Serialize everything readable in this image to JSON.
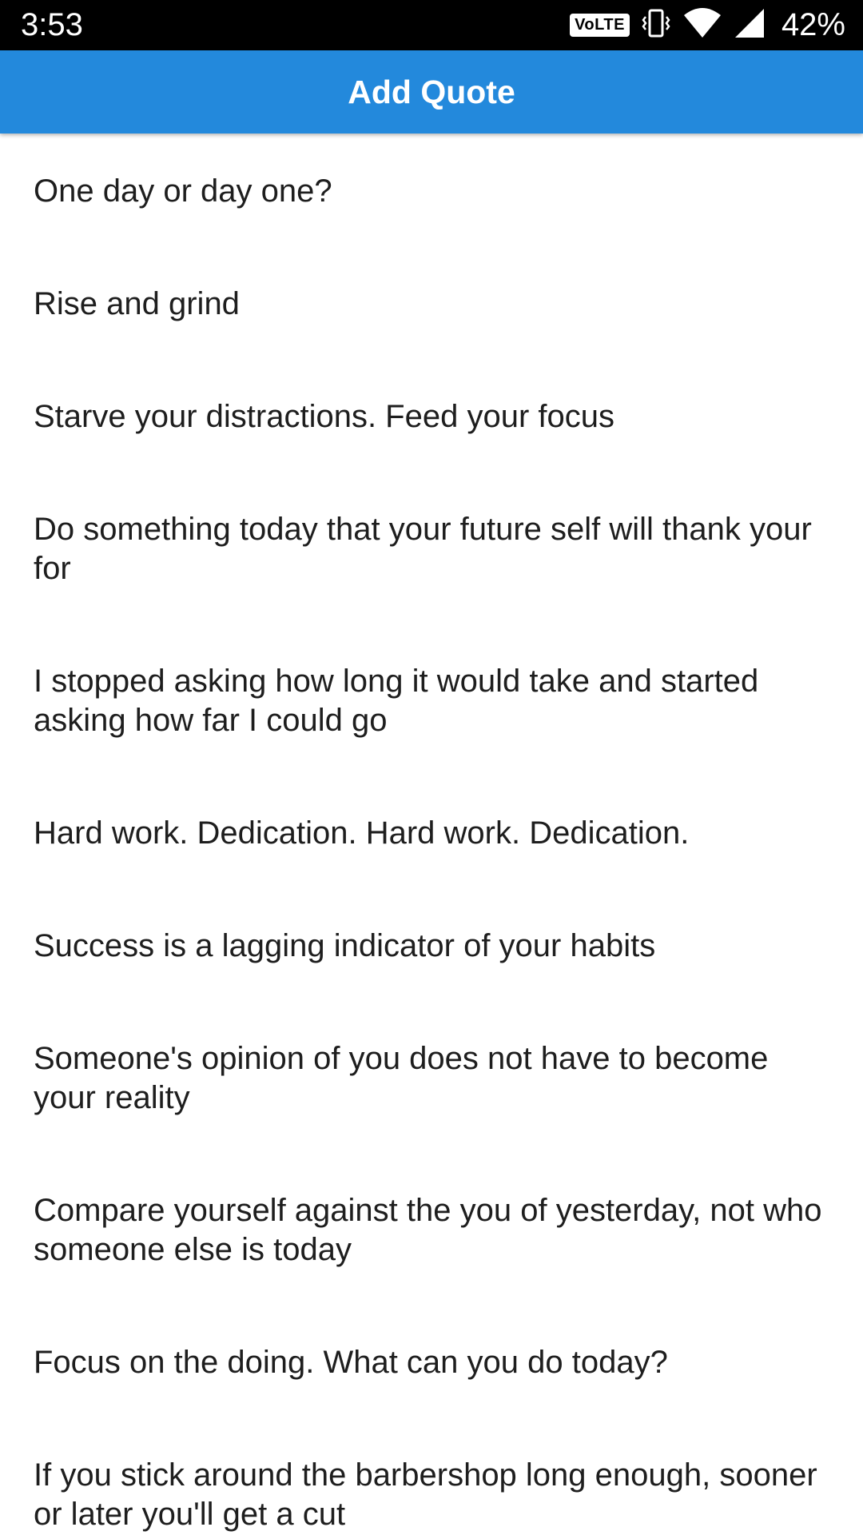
{
  "status_bar": {
    "time": "3:53",
    "volte": "VoLTE",
    "battery": "42%",
    "icons": [
      "volte-icon",
      "vibrate-icon",
      "wifi-icon",
      "signal-icon"
    ]
  },
  "app_bar": {
    "title": "Add Quote",
    "color": "#2389dc"
  },
  "quotes": [
    "One day or day one?",
    "Rise and grind",
    "Starve your distractions. Feed your focus",
    "Do something today that your future self will thank your for",
    "I stopped asking how long it would take and started asking how far I could go",
    "Hard work. Dedication. Hard work. Dedication.",
    "Success is a lagging indicator of your habits",
    "Someone's opinion of you does not have to become your reality",
    "Compare yourself against the you of yesterday, not who someone else is today",
    "Focus on the doing. What can you do today?",
    "If you stick around the barbershop long enough, sooner or later you'll get a cut"
  ]
}
